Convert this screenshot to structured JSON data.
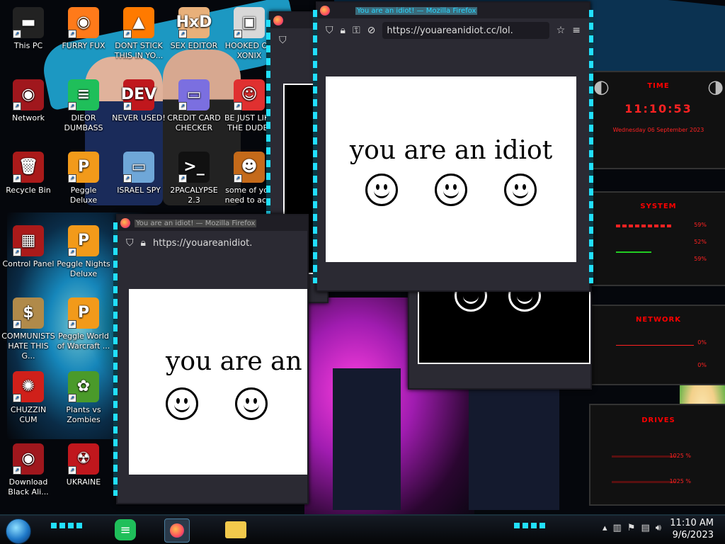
{
  "desktop_icons": [
    {
      "label": "This PC",
      "glyph": "▬",
      "color": "#222"
    },
    {
      "label": "FURRY FUX",
      "glyph": "◉",
      "color": "#ff7a1a"
    },
    {
      "label": "DONT STICK THIS IN YO...",
      "glyph": "▲",
      "color": "#ff7a00"
    },
    {
      "label": "SEX EDITOR",
      "glyph": "HxD",
      "color": "#e8b07a"
    },
    {
      "label": "HOOKED ON XONIX",
      "glyph": "▣",
      "color": "#d8d8d8"
    },
    {
      "label": "Network",
      "glyph": "◉",
      "color": "#a0171d"
    },
    {
      "label": "DIEOR DUMBASS",
      "glyph": "≡",
      "color": "#1fbf5a"
    },
    {
      "label": "NEVER USED!",
      "glyph": "DEV",
      "color": "#c0171d"
    },
    {
      "label": "CREDIT CARD CHECKER",
      "glyph": "▭",
      "color": "#7b6fe0"
    },
    {
      "label": "BE JUST LIKE THE DUDE!",
      "glyph": "☺",
      "color": "#e03030"
    },
    {
      "label": "Recycle Bin",
      "glyph": "🗑",
      "color": "#aa1a1a"
    },
    {
      "label": "Peggle Deluxe",
      "glyph": "P",
      "color": "#f29a1a"
    },
    {
      "label": "ISRAEL SPY",
      "glyph": "▭",
      "color": "#6fa7d8"
    },
    {
      "label": "2PACALYPSE 2.3",
      "glyph": ">_",
      "color": "#111"
    },
    {
      "label": "some of you need to ac...",
      "glyph": "☻",
      "color": "#c46a1a"
    },
    {
      "label": "Control Panel",
      "glyph": "▦",
      "color": "#aa1a1a"
    },
    {
      "label": "Peggle Nights Deluxe",
      "glyph": "P",
      "color": "#f29a1a"
    },
    {
      "label": "COMMUNISTS HATE THIS G...",
      "glyph": "$",
      "color": "#b08a4a"
    },
    {
      "label": "Peggle World of Warcraft ...",
      "glyph": "P",
      "color": "#f29a1a"
    },
    {
      "label": "CHUZZIN CUM",
      "glyph": "✺",
      "color": "#d0201a"
    },
    {
      "label": "Plants vs Zombies",
      "glyph": "✿",
      "color": "#4a9a2a"
    },
    {
      "label": "Download Black Ali...",
      "glyph": "◉",
      "color": "#a0171d"
    },
    {
      "label": "UKRAINE",
      "glyph": "☢",
      "color": "#c0171d"
    }
  ],
  "widgets": {
    "time": {
      "title": "TIME",
      "clock": "11:10:53",
      "date": "Wednesday 06 September 2023"
    },
    "system": {
      "title": "SYSTEM",
      "cpu": "59%",
      "ram": "52%",
      "swap": "59%"
    },
    "network": {
      "title": "NETWORK",
      "up": "0%",
      "down": "0%"
    },
    "drives": {
      "title": "DRIVES",
      "c": "1025 %",
      "d": "1025 %"
    }
  },
  "browser": {
    "title": "You are an idiot! — Mozilla Firefox",
    "url_full": "https://youareanidiot.cc/lol.",
    "url_short": "https://youareanidiot.",
    "message": "you are an idiot"
  },
  "taskbar": {
    "time": "11:10 AM",
    "date": "9/6/2023"
  }
}
